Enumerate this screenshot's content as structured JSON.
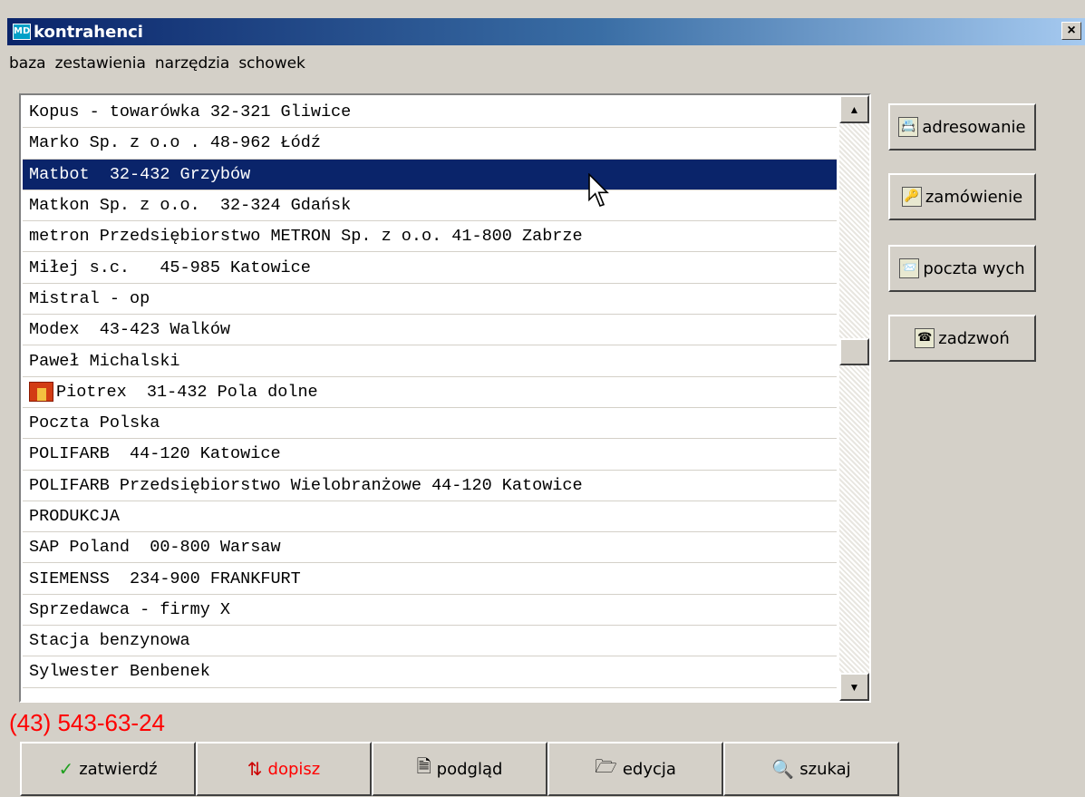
{
  "window": {
    "title": "kontrahenci",
    "close_label": "×"
  },
  "menu": [
    "baza",
    "zestawienia",
    "narzędzia",
    "schowek"
  ],
  "list": {
    "items": [
      {
        "text": "Kopus - towarówka 32-321 Gliwice",
        "selected": false,
        "icon": null
      },
      {
        "text": "Marko Sp. z o.o . 48-962 Łódź",
        "selected": false,
        "icon": null
      },
      {
        "text": "Matbot  32-432 Grzybów",
        "selected": true,
        "icon": null
      },
      {
        "text": "Matkon Sp. z o.o.  32-324 Gdańsk",
        "selected": false,
        "icon": null
      },
      {
        "text": "metron Przedsiębiorstwo METRON Sp. z o.o. 41-800 Zabrze",
        "selected": false,
        "icon": null
      },
      {
        "text": "Miłej s.c.   45-985 Katowice",
        "selected": false,
        "icon": null
      },
      {
        "text": "Mistral - op",
        "selected": false,
        "icon": null
      },
      {
        "text": "Modex  43-423 Walków",
        "selected": false,
        "icon": null
      },
      {
        "text": "Paweł Michalski",
        "selected": false,
        "icon": null
      },
      {
        "text": "Piotrex  31-432 Pola dolne",
        "selected": false,
        "icon": "house-icon"
      },
      {
        "text": "Poczta Polska",
        "selected": false,
        "icon": null
      },
      {
        "text": "POLIFARB  44-120 Katowice",
        "selected": false,
        "icon": null
      },
      {
        "text": "POLIFARB Przedsiębiorstwo Wielobranżowe 44-120 Katowice",
        "selected": false,
        "icon": null
      },
      {
        "text": "PRODUKCJA",
        "selected": false,
        "icon": null
      },
      {
        "text": "SAP Poland  00-800 Warsaw",
        "selected": false,
        "icon": null
      },
      {
        "text": "SIEMENSS  234-900 FRANKFURT",
        "selected": false,
        "icon": null
      },
      {
        "text": "Sprzedawca - firmy X",
        "selected": false,
        "icon": null
      },
      {
        "text": "Stacja benzynowa",
        "selected": false,
        "icon": null
      },
      {
        "text": "Sylwester Benbenek",
        "selected": false,
        "icon": null
      }
    ],
    "selection_color": "#0a246a"
  },
  "side_buttons": [
    {
      "label": "adresowanie",
      "icon": "address-book-icon",
      "icon_glyph": "📇"
    },
    {
      "label": "zamówienie",
      "icon": "order-keys-icon",
      "icon_glyph": "🔑"
    },
    {
      "label": "poczta wych",
      "icon": "outbox-mail-icon",
      "icon_glyph": "📨"
    },
    {
      "label": "zadzwoń",
      "icon": "phone-icon",
      "icon_glyph": "☎"
    }
  ],
  "phone": {
    "number": "(43) 543-63-24",
    "color": "#ff0000"
  },
  "bottom_buttons": [
    {
      "label": "zatwierdź",
      "icon": "checkmark-icon",
      "glyph": "✓"
    },
    {
      "label": "dopisz",
      "icon": "add-record-icon",
      "glyph": "⇅"
    },
    {
      "label": "podgląd",
      "icon": "preview-icon",
      "glyph": "🗎"
    },
    {
      "label": "edycja",
      "icon": "folder-open-icon",
      "glyph": "🗁"
    },
    {
      "label": "szukaj",
      "icon": "search-icon",
      "glyph": "🔍"
    }
  ]
}
